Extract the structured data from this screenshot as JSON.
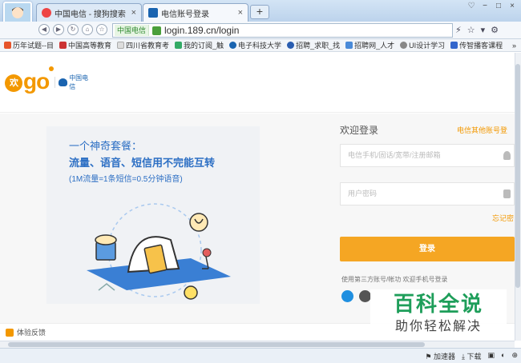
{
  "browser": {
    "tabs": [
      {
        "title": "中国电信 - 搜狗搜索",
        "close": "×"
      },
      {
        "title": "电信账号登录",
        "close": "×"
      }
    ],
    "new_tab": "+",
    "url_badge": "中国电信",
    "url": "login.189.cn/login",
    "window_controls": [
      "♡",
      "−",
      "□",
      "×"
    ],
    "nav_right": [
      "⚡",
      "☆",
      "▾",
      "⚙"
    ],
    "bookmarks": [
      "历年试题--目",
      "中国高等教育",
      "四川省教育考",
      "我的订阅_触",
      "电子科技大学",
      "招聘_求职_找",
      "招聘网_人才",
      "UI设计学习",
      "传智播客课程"
    ],
    "bookmarks_more": "»",
    "status": {
      "accelerator": "加速器",
      "download": "下载"
    }
  },
  "page": {
    "logo_char": "欢",
    "logo_text": "go",
    "telecom_name": "中国电信",
    "promo": {
      "line1": "一个神奇套餐：",
      "line2": "流量、语音、短信用不完能互转",
      "line3": "(1M流量=1条短信=0.5分钟语音)"
    },
    "login": {
      "title": "欢迎登录",
      "other_account": "电信其他账号登",
      "phone_placeholder": "电信手机/固话/宽带/注册邮箱",
      "password_placeholder": "用户密码",
      "forget": "忘记密",
      "submit": "登录",
      "third_party": "使用第三方账号/帐功    欢迎手机号登录"
    },
    "footer": {
      "feedback": "体验反馈"
    }
  },
  "watermark": {
    "title": "百科全说",
    "subtitle": "助你轻松解决"
  },
  "colors": {
    "accent": "#f39800",
    "promo_blue": "#2c6fc4",
    "button": "#f5a623"
  }
}
